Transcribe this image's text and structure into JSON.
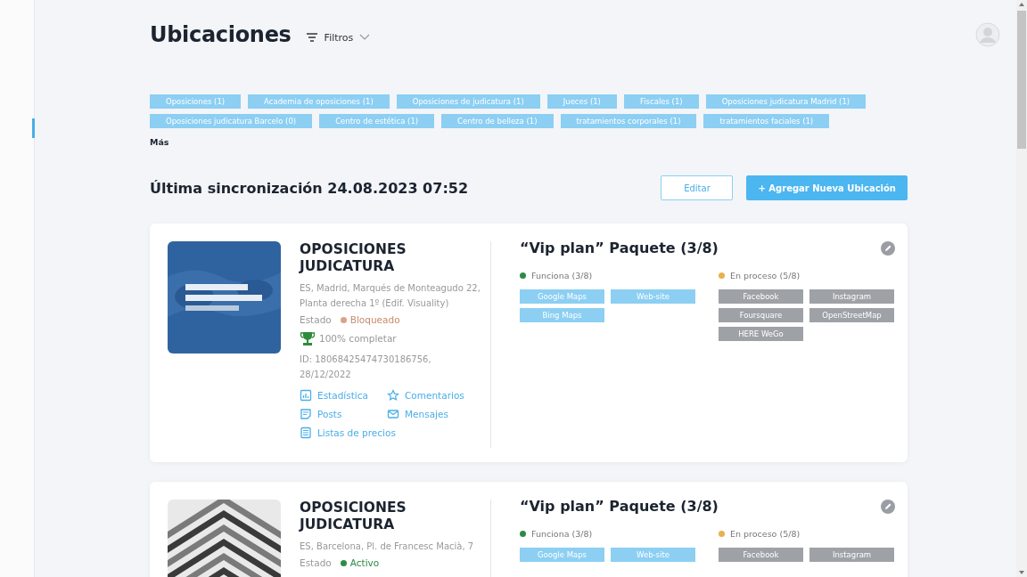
{
  "header": {
    "title": "Ubicaciones",
    "filter_label": "Filtros"
  },
  "tags": [
    "Oposiciones (1)",
    "Academia de oposiciones (1)",
    "Oposiciones de judicatura (1)",
    "Jueces (1)",
    "Fiscales (1)",
    "Oposiciones judicatura Madrid (1)",
    "Oposiciones judicatura Barcelo (0)",
    "Centro de estética (1)",
    "Centro de belleza (1)",
    "tratamientos corporales (1)",
    "tratamientos faciales (1)"
  ],
  "more_link": "Más",
  "sync": {
    "title": "Última sincronización 24.08.2023 07:52",
    "buttons": [
      {
        "label": "Editar",
        "kind": "outline"
      },
      {
        "label": "+ Agregar Nueva Ubicación",
        "kind": "primary"
      }
    ]
  },
  "locations": [
    {
      "image": {
        "kind": "picture"
      },
      "name": "OPOSICIONES JUDICATURA",
      "address": "ES, Madrid, Marqués de Monteagudo 22, Planta derecha 1º (Edif. Visuality)",
      "status_label": "Estado",
      "status": {
        "text": "Bloqueado",
        "kind": "blocked"
      },
      "completion": "100% completar",
      "id": "ID: 18068425474730186756, 28/12/2022",
      "links": [
        {
          "label": "Estadística",
          "kind": "statistics"
        },
        {
          "label": "Comentarios",
          "kind": "reviews"
        },
        {
          "label": "Posts",
          "kind": "posts"
        },
        {
          "label": "Mensajes",
          "kind": "messages"
        },
        {
          "label": "Listas de precios",
          "kind": "prices"
        }
      ],
      "plan": "“Vip plan” Paquete (3/8)",
      "groups": [
        {
          "label": "Funciona (3/8)",
          "kind": "working",
          "items": [
            "Google Maps",
            "Web-site",
            "Bing Maps"
          ]
        },
        {
          "label": "En proceso (5/8)",
          "kind": "pending",
          "items": [
            "Facebook",
            "Instagram",
            "Foursquare",
            "OpenStreetMap",
            "HERE WeGo"
          ]
        }
      ]
    },
    {
      "image": {
        "kind": "picture"
      },
      "name": "OPOSICIONES JUDICATURA",
      "address": "ES, Barcelona, Pl. de Francesc Macià, 7",
      "status_label": "Estado",
      "status": {
        "text": "Activo",
        "kind": "active"
      },
      "plan": "“Vip plan” Paquete (3/8)",
      "groups": [
        {
          "label": "Funciona (3/8)",
          "kind": "working",
          "items": [
            "Google Maps",
            "Web-site"
          ]
        },
        {
          "label": "En proceso (5/8)",
          "kind": "pending",
          "items": [
            "Facebook",
            "Instagram"
          ]
        }
      ]
    }
  ]
}
